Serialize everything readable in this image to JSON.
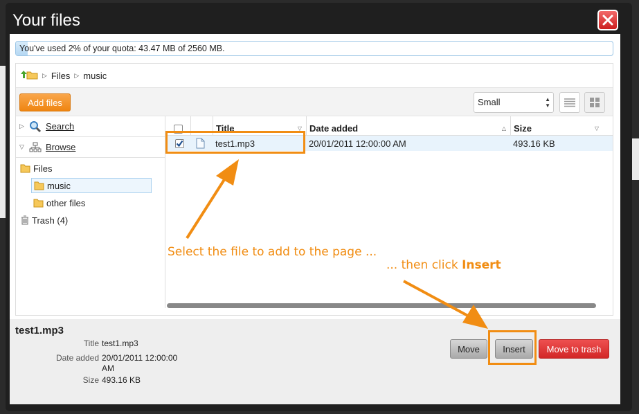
{
  "dialog": {
    "title": "Your files",
    "quota_text": "You've used 2% of your quota: 43.47 MB of 2560 MB.",
    "quota_percent": 2
  },
  "breadcrumb": {
    "items": [
      "Files",
      "music"
    ]
  },
  "toolbar": {
    "add_files_label": "Add files",
    "size_selected": "Small"
  },
  "sidebar": {
    "search_label": "Search",
    "browse_label": "Browse",
    "tree": {
      "files": "Files",
      "music": "music",
      "other": "other files",
      "trash": "Trash (4)"
    }
  },
  "table": {
    "columns": {
      "title": "Title",
      "date": "Date added",
      "size": "Size"
    },
    "rows": [
      {
        "title": "test1.mp3",
        "date": "20/01/2011 12:00:00 AM",
        "size": "493.16 KB",
        "checked": true
      }
    ]
  },
  "details": {
    "filename": "test1.mp3",
    "title_label": "Title",
    "title_value": "test1.mp3",
    "date_label": "Date added",
    "date_value": "20/01/2011 12:00:00 AM",
    "size_label": "Size",
    "size_value": "493.16 KB"
  },
  "buttons": {
    "move": "Move",
    "insert": "Insert",
    "trash": "Move to trash"
  },
  "annotations": {
    "select_text": "Select the file to add to the page ...",
    "then_text": "... then click ",
    "then_bold": "Insert"
  },
  "colors": {
    "accent_orange": "#f18d13",
    "add_button": "#ef8511",
    "trash_button": "#d22626"
  }
}
